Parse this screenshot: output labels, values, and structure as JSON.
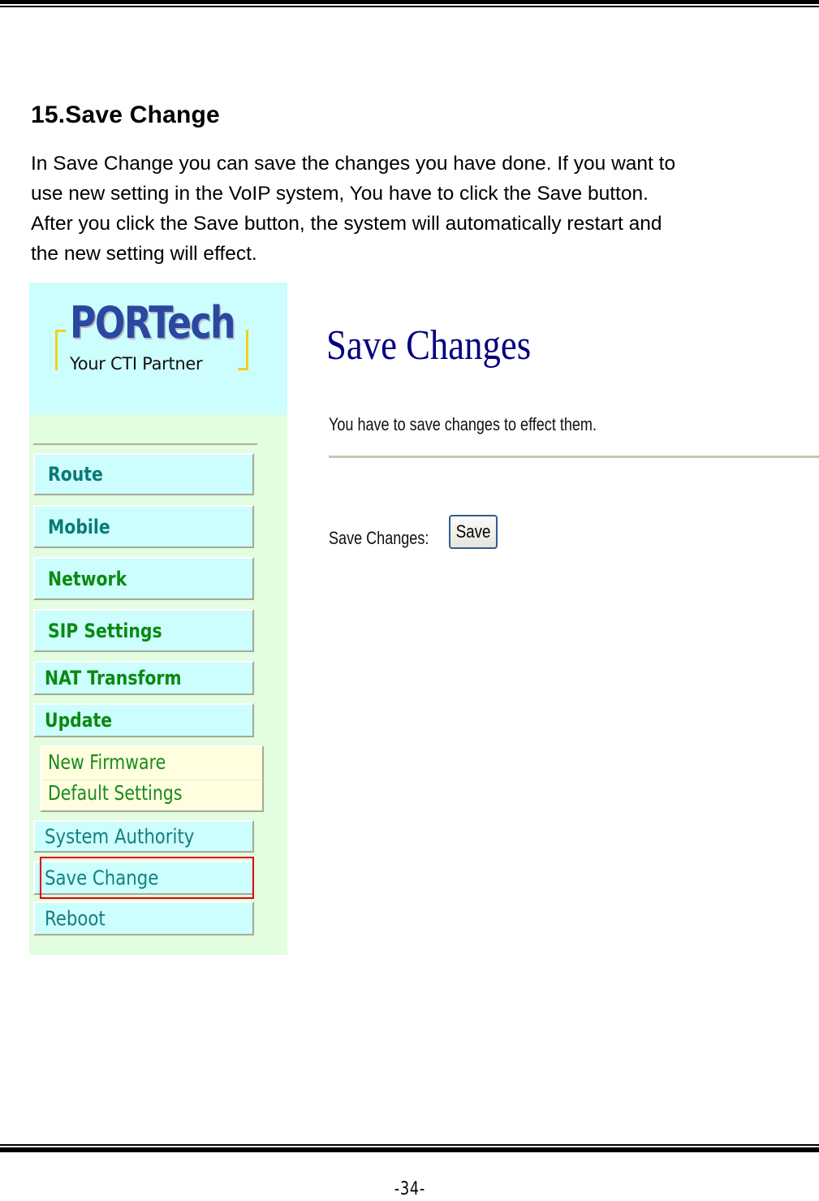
{
  "section": {
    "title": "15.Save Change",
    "intro_lines": [
      "In Save Change you can save the changes you have done. If you want to",
      "use new setting in the VoIP system, You have to click the Save button.",
      "After you click the Save button, the system will automatically restart and",
      "the new setting will effect."
    ]
  },
  "screenshot": {
    "logo": {
      "brand": "PORTech",
      "tagline": "Your CTI Partner"
    },
    "sidebar": {
      "items": [
        {
          "label": "Route"
        },
        {
          "label": "Mobile"
        },
        {
          "label": "Network"
        },
        {
          "label": "SIP Settings"
        },
        {
          "label": "NAT Transform"
        },
        {
          "label": "Update"
        }
      ],
      "update_submenu": [
        {
          "label": "New Firmware"
        },
        {
          "label": "Default Settings"
        }
      ],
      "lower_items": [
        {
          "label": "System Authority"
        },
        {
          "label": "Save Change",
          "highlighted": true
        },
        {
          "label": "Reboot"
        }
      ]
    },
    "main": {
      "title": "Save Changes",
      "description": "You have to save changes to effect them.",
      "save_label": "Save Changes:",
      "save_button": "Save"
    },
    "colors": {
      "highlight": "#e00000",
      "title": "#00007f",
      "nav_bg": "#ccfefd",
      "sidebar_bg": "#e2fde0"
    }
  },
  "footer": {
    "page_number": "-34-"
  }
}
